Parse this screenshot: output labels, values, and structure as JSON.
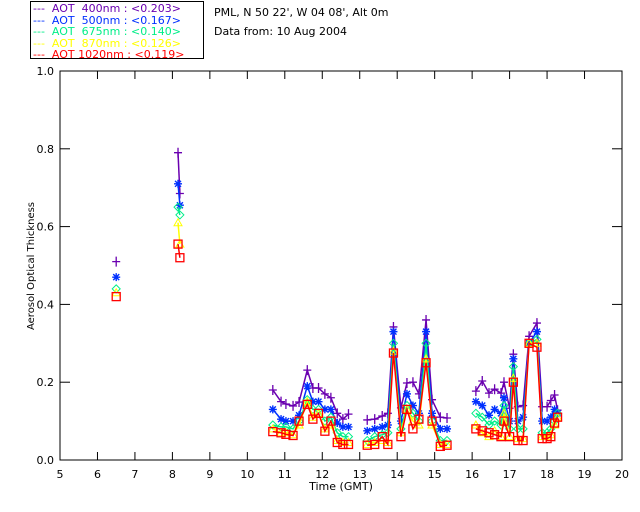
{
  "header": {
    "site": "PML, N 50 22', W 04 08', Alt 0m",
    "date": "Data from: 10 Aug 2004"
  },
  "chart_data": {
    "type": "scatter",
    "xlabel": "Time (GMT)",
    "ylabel": "Aerosol Optical Thickness",
    "xlim": [
      5,
      20
    ],
    "ylim": [
      0.0,
      1.0
    ],
    "xticks": [
      "5",
      "6",
      "7",
      "8",
      "9",
      "10",
      "11",
      "12",
      "13",
      "14",
      "15",
      "16",
      "17",
      "18",
      "19",
      "20"
    ],
    "yticks": [
      "0.0",
      "0.2",
      "0.4",
      "0.6",
      "0.8",
      "1.0"
    ],
    "grid": false,
    "legend_position": "top-left",
    "x": [
      6.5,
      8.15,
      8.2,
      10.68,
      10.9,
      11.03,
      11.22,
      11.38,
      11.6,
      11.75,
      11.9,
      12.07,
      12.23,
      12.4,
      12.55,
      12.7,
      13.2,
      13.4,
      13.6,
      13.75,
      13.9,
      14.1,
      14.26,
      14.42,
      14.58,
      14.77,
      14.93,
      15.15,
      15.33,
      16.1,
      16.27,
      16.45,
      16.6,
      16.77,
      16.85,
      17.0,
      17.1,
      17.22,
      17.36,
      17.52,
      17.73,
      17.87,
      18.0,
      18.1,
      18.2,
      18.28
    ],
    "series": [
      {
        "name": "AOT  400nm : <0.203>",
        "color": "#6a00b0",
        "marker": "plus",
        "values": [
          0.51,
          0.79,
          0.685,
          0.18,
          0.15,
          0.144,
          0.139,
          0.149,
          0.231,
          0.185,
          0.185,
          0.17,
          0.16,
          0.12,
          0.105,
          0.118,
          0.103,
          0.105,
          0.113,
          0.12,
          0.342,
          0.134,
          0.198,
          0.2,
          0.17,
          0.36,
          0.155,
          0.11,
          0.108,
          0.177,
          0.203,
          0.172,
          0.182,
          0.172,
          0.2,
          0.133,
          0.272,
          0.137,
          0.14,
          0.318,
          0.352,
          0.137,
          0.137,
          0.153,
          0.167,
          0.128
        ]
      },
      {
        "name": "AOT  500nm : <0.167>",
        "color": "#0030ff",
        "marker": "asterisk",
        "values": [
          0.47,
          0.71,
          0.655,
          0.13,
          0.105,
          0.1,
          0.1,
          0.115,
          0.19,
          0.15,
          0.15,
          0.13,
          0.13,
          0.095,
          0.085,
          0.085,
          0.075,
          0.08,
          0.085,
          0.09,
          0.33,
          0.1,
          0.17,
          0.14,
          0.12,
          0.33,
          0.12,
          0.08,
          0.08,
          0.15,
          0.14,
          0.115,
          0.13,
          0.12,
          0.16,
          0.1,
          0.26,
          0.1,
          0.11,
          0.3,
          0.33,
          0.1,
          0.1,
          0.11,
          0.13,
          0.12
        ]
      },
      {
        "name": "AOT  675nm : <0.140>",
        "color": "#00ee88",
        "marker": "diamond",
        "values": [
          0.44,
          0.65,
          0.63,
          0.09,
          0.085,
          0.085,
          0.08,
          0.1,
          0.155,
          0.13,
          0.13,
          0.1,
          0.11,
          0.07,
          0.06,
          0.06,
          0.05,
          0.06,
          0.065,
          0.07,
          0.3,
          0.08,
          0.14,
          0.12,
          0.1,
          0.3,
          0.1,
          0.05,
          0.05,
          0.12,
          0.11,
          0.09,
          0.1,
          0.09,
          0.14,
          0.08,
          0.24,
          0.08,
          0.08,
          0.3,
          0.31,
          0.07,
          0.07,
          0.08,
          0.1,
          0.12
        ]
      },
      {
        "name": "AOT  870nm : <0.126>",
        "color": "#ffff00",
        "marker": "triangle",
        "values": [
          0.43,
          0.61,
          0.555,
          0.08,
          0.07,
          0.07,
          0.065,
          0.09,
          0.15,
          0.11,
          0.12,
          0.08,
          0.09,
          0.05,
          0.045,
          0.045,
          0.04,
          0.045,
          0.05,
          0.045,
          0.28,
          0.07,
          0.13,
          0.1,
          0.09,
          0.26,
          0.09,
          0.04,
          0.04,
          0.09,
          0.07,
          0.06,
          0.075,
          0.06,
          0.12,
          0.06,
          0.21,
          0.055,
          0.055,
          0.3,
          0.3,
          0.06,
          0.06,
          0.065,
          0.09,
          0.11
        ]
      },
      {
        "name": "AOT 1020nm : <0.119>",
        "color": "#ff0000",
        "marker": "square",
        "values": [
          0.42,
          0.555,
          0.52,
          0.073,
          0.07,
          0.066,
          0.063,
          0.1,
          0.143,
          0.105,
          0.12,
          0.074,
          0.1,
          0.045,
          0.04,
          0.04,
          0.038,
          0.04,
          0.06,
          0.04,
          0.275,
          0.06,
          0.13,
          0.08,
          0.105,
          0.25,
          0.1,
          0.035,
          0.038,
          0.08,
          0.075,
          0.07,
          0.065,
          0.06,
          0.1,
          0.06,
          0.2,
          0.05,
          0.05,
          0.3,
          0.29,
          0.055,
          0.055,
          0.06,
          0.095,
          0.11
        ]
      }
    ]
  }
}
